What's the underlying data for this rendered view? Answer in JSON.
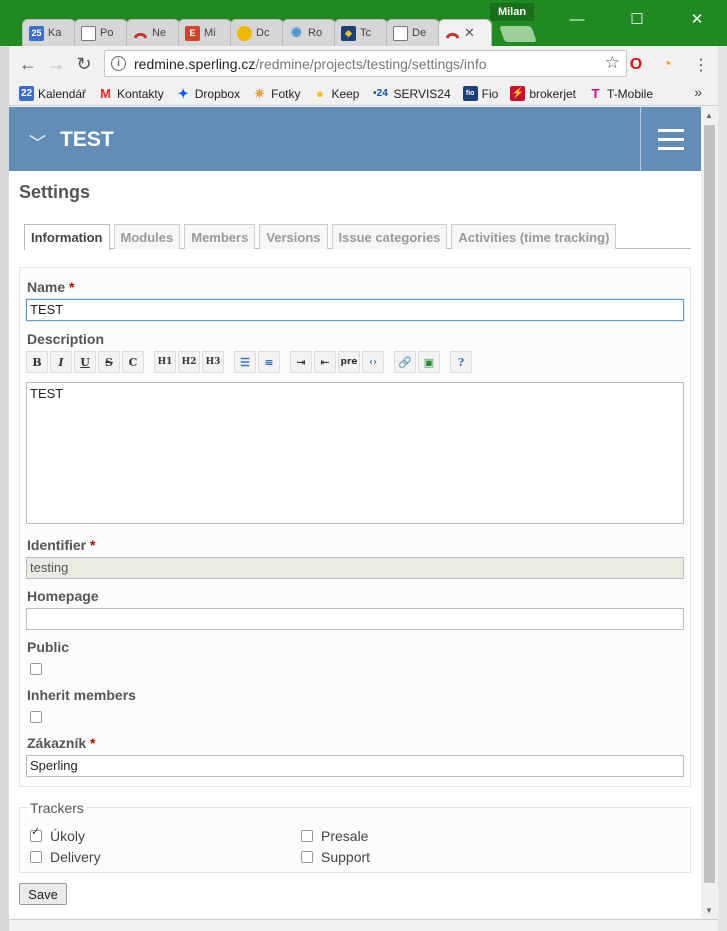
{
  "browser": {
    "profile_name": "Milan",
    "tabs": [
      {
        "title": "Ka",
        "icon": "calendar-icon",
        "badge": "25",
        "color": "#3a6fc9"
      },
      {
        "title": "Po",
        "icon": "document-icon",
        "badge": "",
        "color": "#ffffff"
      },
      {
        "title": "Ne",
        "icon": "redmine-icon",
        "badge": "",
        "color": "#ffffff"
      },
      {
        "title": "Mi",
        "icon": "e-icon",
        "badge": "E",
        "color": "#d0452b"
      },
      {
        "title": "Dc",
        "icon": "circle-icon",
        "badge": "",
        "color": "#f1b800"
      },
      {
        "title": "Ro",
        "icon": "gear-icon",
        "badge": "",
        "color": "#7ab6e3"
      },
      {
        "title": "Tc",
        "icon": "bank-icon",
        "badge": "",
        "color": "#1b3f7a"
      },
      {
        "title": "De",
        "icon": "document-icon",
        "badge": "",
        "color": "#ffffff"
      },
      {
        "title": "",
        "icon": "redmine-icon",
        "badge": "",
        "color": "#ffffff",
        "active": true
      }
    ],
    "url_host": "redmine.sperling.cz",
    "url_path": "/redmine/projects/testing/settings/info",
    "bookmarks": [
      {
        "label": "Kalendář",
        "icon": "calendar-icon",
        "badge": "22",
        "color": "#3a6fc9"
      },
      {
        "label": "Kontakty",
        "icon": "gmail-icon",
        "badge": "M",
        "color": "#d93025"
      },
      {
        "label": "Dropbox",
        "icon": "dropbox-icon",
        "badge": "✦",
        "color": "#0061fe"
      },
      {
        "label": "Fotky",
        "icon": "photos-icon",
        "badge": "✷",
        "color": "#e8a13a"
      },
      {
        "label": "Keep",
        "icon": "keep-icon",
        "badge": "●",
        "color": "#f6c026"
      },
      {
        "label": "SERVIS24",
        "icon": "servis24-icon",
        "badge": "•24",
        "color": "#0a4fa0"
      },
      {
        "label": "Fio",
        "icon": "fio-icon",
        "badge": "fio",
        "color": "#1b3f7a"
      },
      {
        "label": "brokerjet",
        "icon": "brokerjet-icon",
        "badge": "⚡",
        "color": "#c8102e"
      },
      {
        "label": "T-Mobile",
        "icon": "tmobile-icon",
        "badge": "T",
        "color": "#e20074"
      }
    ],
    "more_glyph": "»"
  },
  "header": {
    "project_title": "TEST"
  },
  "page_title": "Settings",
  "tabs": [
    {
      "label": "Information",
      "active": true
    },
    {
      "label": "Modules"
    },
    {
      "label": "Members"
    },
    {
      "label": "Versions"
    },
    {
      "label": "Issue categories"
    },
    {
      "label": "Activities (time tracking)"
    }
  ],
  "form": {
    "name_label": "Name",
    "name_value": "TEST",
    "description_label": "Description",
    "toolbar": [
      "B",
      "I",
      "U",
      "S",
      "C",
      "H1",
      "H2",
      "H3",
      "ul",
      "ol",
      "in",
      "out",
      "pre",
      "<>",
      "link",
      "img",
      "?"
    ],
    "description_value": "TEST",
    "identifier_label": "Identifier",
    "identifier_value": "testing",
    "homepage_label": "Homepage",
    "homepage_value": "",
    "public_label": "Public",
    "public_checked": false,
    "inherit_label": "Inherit members",
    "inherit_checked": false,
    "customer_label": "Zákazník",
    "customer_value": "Sperling",
    "required_mark": "*"
  },
  "trackers": {
    "legend": "Trackers",
    "items": [
      {
        "label": "Úkoly",
        "checked": true
      },
      {
        "label": "Presale",
        "checked": false
      },
      {
        "label": "Delivery",
        "checked": false
      },
      {
        "label": "Support",
        "checked": false
      }
    ]
  },
  "save_label": "Save"
}
